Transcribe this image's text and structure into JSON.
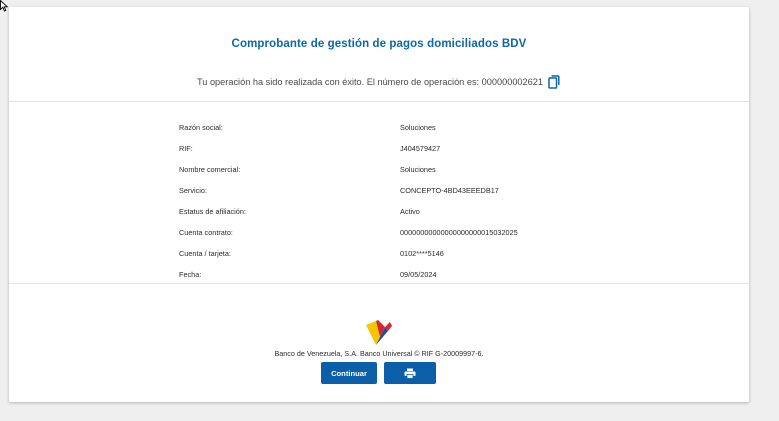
{
  "header": {
    "title": "Comprobante de gestión de pagos domiciliados BDV",
    "success_message": "Tu operación ha sido realizada con éxito. El número de operación es: 000000002621"
  },
  "details": [
    {
      "label": "Razón social:",
      "value": "Soluciones"
    },
    {
      "label": "RIF:",
      "value": "J404579427"
    },
    {
      "label": "Nombre comercial:",
      "value": "Soluciones"
    },
    {
      "label": "Servicio:",
      "value": "CONCEPTO-4BD43EEEDB17"
    },
    {
      "label": "Estatus de afiliación:",
      "value": "Activo"
    },
    {
      "label": "Cuenta contrato:",
      "value": "00000000000000000000015032025"
    },
    {
      "label": "Cuenta / tarjeta:",
      "value": "0102****5146"
    },
    {
      "label": "Fecha:",
      "value": "09/05/2024"
    }
  ],
  "footer": {
    "bank_text": "Banco de Venezuela, S.A. Banco Universal © RIF G-20009997-6.",
    "continue_label": "Continuar"
  },
  "icons": {
    "copy": "copy-icon",
    "print": "printer-icon",
    "logo": "bdv-logo"
  },
  "colors": {
    "accent": "#0b67a8",
    "button": "#0b5fa8",
    "logo_yellow": "#f7c600",
    "logo_red": "#d7282f",
    "logo_blue": "#1f4fa3"
  }
}
